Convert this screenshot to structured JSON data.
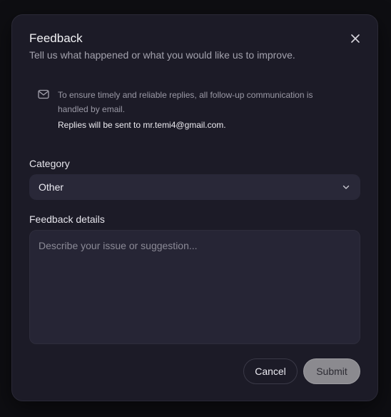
{
  "dialog": {
    "title": "Feedback",
    "subtitle": "Tell us what happened or what you would like us to improve.",
    "close_icon": "close-icon"
  },
  "notice": {
    "icon": "mail-icon",
    "text": "To ensure timely and reliable replies, all follow-up communication is handled by email.",
    "reply_line": "Replies will be sent to mr.temi4@gmail.com."
  },
  "form": {
    "category_label": "Category",
    "category_value": "Other",
    "details_label": "Feedback details",
    "details_placeholder": "Describe your issue or suggestion...",
    "details_value": ""
  },
  "actions": {
    "cancel_label": "Cancel",
    "submit_label": "Submit"
  },
  "colors": {
    "modal_bg": "#1c1b27",
    "input_bg": "#292838",
    "submit_bg": "#8b8a8f"
  }
}
